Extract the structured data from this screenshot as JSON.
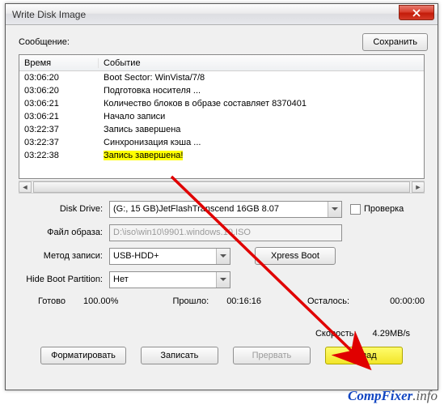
{
  "window": {
    "title": "Write Disk Image"
  },
  "labels": {
    "message": "Сообщение:",
    "save_btn": "Сохранить",
    "col_time": "Время",
    "col_event": "Событие",
    "disk_drive": "Disk Drive:",
    "verify": "Проверка",
    "image_file": "Файл образа:",
    "write_method": "Метод записи:",
    "xpress": "Xpress Boot",
    "hide_boot": "Hide Boot Partition:",
    "ready": "Готово",
    "elapsed": "Прошло:",
    "remaining": "Осталось:",
    "speed": "Скорость:",
    "format_btn": "Форматировать",
    "write_btn": "Записать",
    "abort_btn": "Прервать",
    "back_btn": "Назад"
  },
  "log": [
    {
      "t": "03:06:20",
      "e": "Boot Sector: WinVista/7/8"
    },
    {
      "t": "03:06:20",
      "e": "Подготовка носителя ..."
    },
    {
      "t": "03:06:21",
      "e": "Количество блоков в образе составляет 8370401"
    },
    {
      "t": "03:06:21",
      "e": "Начало записи"
    },
    {
      "t": "03:22:37",
      "e": "Запись завершена"
    },
    {
      "t": "03:22:37",
      "e": "Синхронизация кэша ..."
    },
    {
      "t": "03:22:38",
      "e": "Запись завершена!",
      "hl": true
    }
  ],
  "fields": {
    "disk_drive_value": "(G:, 15 GB)JetFlashTranscend 16GB  8.07",
    "image_file_value": "D:\\iso\\win10\\9901.windows.10.ISO",
    "write_method_value": "USB-HDD+",
    "hide_boot_value": "Нет"
  },
  "status": {
    "percent": "100.00%",
    "elapsed_time": "00:16:16",
    "remaining_time": "00:00:00",
    "speed_value": "4.29MB/s"
  },
  "watermark": {
    "a": "CompFixer",
    "b": ".info"
  }
}
